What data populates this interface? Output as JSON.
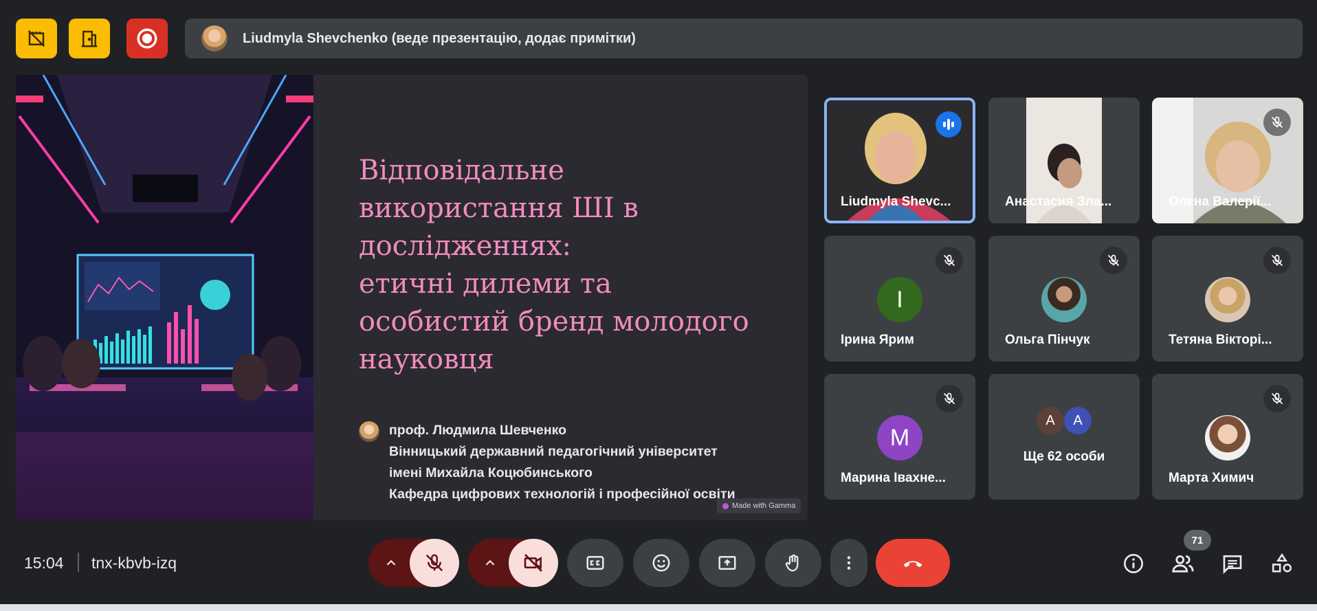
{
  "top_bar": {
    "presenter_text": "Liudmyla Shevchenko (веде презентацію, додає примітки)"
  },
  "slide": {
    "title_lines": [
      "Відповідальне",
      "використання ШІ в",
      "дослідженнях:",
      "етичні дилеми та",
      "особистий бренд молодого",
      "науковця"
    ],
    "author_lines": [
      "проф. Людмила Шевченко",
      "Вінницький державний педагогічний університет",
      "імені Михайла Коцюбинського",
      "Кафедра цифрових технологій і професійної освіти"
    ],
    "gamma_badge": "Made with Gamma"
  },
  "participants": [
    {
      "name": "Liudmyla Shevc...",
      "speaking": true
    },
    {
      "name": "Анастасия Зла..."
    },
    {
      "name": "Олена Валерії...",
      "muted": true
    },
    {
      "name": "Ірина Ярим",
      "initial": "I",
      "color": "#33691e",
      "muted": true
    },
    {
      "name": "Ольга Пінчук",
      "muted": true
    },
    {
      "name": "Тетяна Вікторі...",
      "muted": true
    },
    {
      "name": "Марина Івахне...",
      "initial": "M",
      "color": "#8e44c4",
      "muted": true
    },
    {
      "name": "Ще 62 особи",
      "initials": [
        "A",
        "A"
      ]
    },
    {
      "name": "Марта Химич",
      "muted": true
    }
  ],
  "bottom_bar": {
    "time": "15:04",
    "meeting_code": "tnx-kbvb-izq",
    "people_count": "71"
  },
  "colors": {
    "background": "#202124",
    "accent_blue": "#8ab4f8",
    "end_call": "#ea4335",
    "slide_title": "#f18bc0"
  }
}
